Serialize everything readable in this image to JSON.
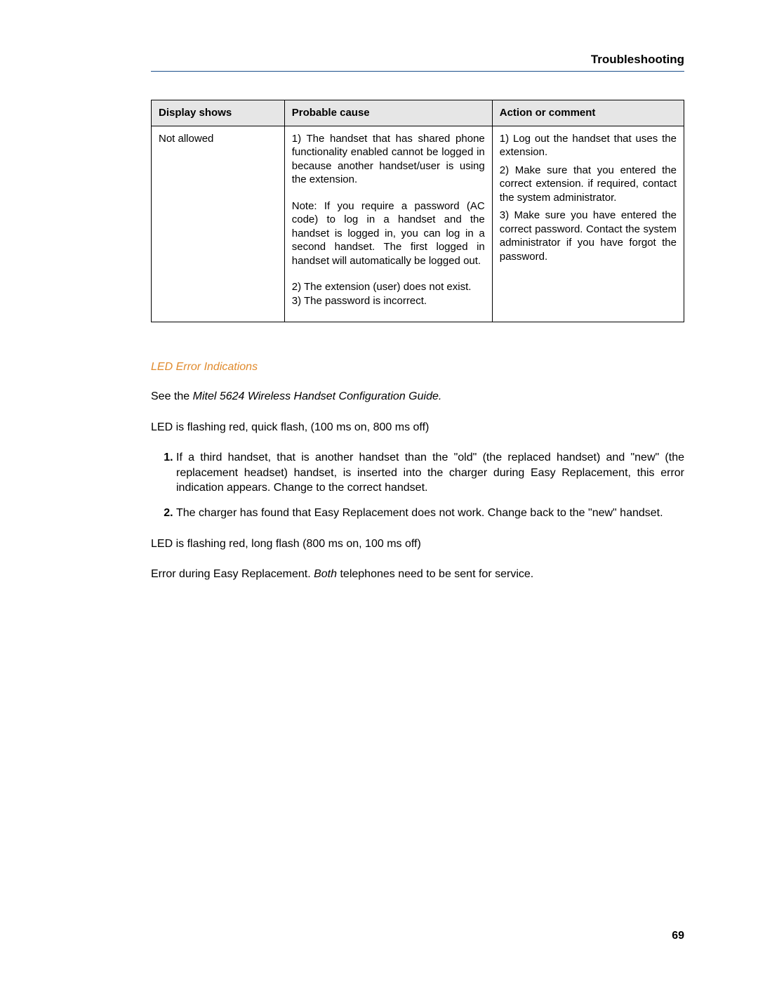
{
  "header": {
    "title": "Troubleshooting"
  },
  "table": {
    "headers": [
      "Display shows",
      "Probable cause",
      "Action or comment"
    ],
    "row": {
      "display": "Not allowed",
      "cause": {
        "p1": "1) The handset that has shared phone functionality enabled cannot be logged in because another handset/user is using the extension.",
        "p2": "Note: If you require a password (AC code) to log in a handset and the handset is logged in, you can log in a second handset. The first logged in handset will automatically be logged out.",
        "p3": "2) The extension (user) does not exist.",
        "p4": "3) The password is incorrect."
      },
      "action": {
        "p1": "1) Log out the handset that uses the extension.",
        "p2": "2) Make sure that you entered the correct extension. if required, contact the system administrator.",
        "p3": "3) Make sure you have entered the correct password. Contact the system administrator if you have forgot the password."
      }
    }
  },
  "section": {
    "heading": "LED Error Indications",
    "see_prefix": "See the ",
    "see_italic": "Mitel 5624 Wireless Handset Configuration Guide.",
    "led_quick": "LED is flashing red, quick flash, (100 ms on, 800 ms off)",
    "list": [
      "If a third handset, that is another handset than the \"old\" (the replaced handset) and \"new\" (the replacement headset) handset, is inserted into the charger during Easy Replacement, this error indication appears. Change to the correct handset.",
      "The charger has found that Easy Replacement does not work. Change back to the \"new\" handset."
    ],
    "led_long": "LED is flashing red, long flash (800 ms on, 100 ms off)",
    "error_prefix": "Error during Easy Replacement. ",
    "error_italic": "Both",
    "error_suffix": " telephones need to be sent for service."
  },
  "page_number": "69"
}
